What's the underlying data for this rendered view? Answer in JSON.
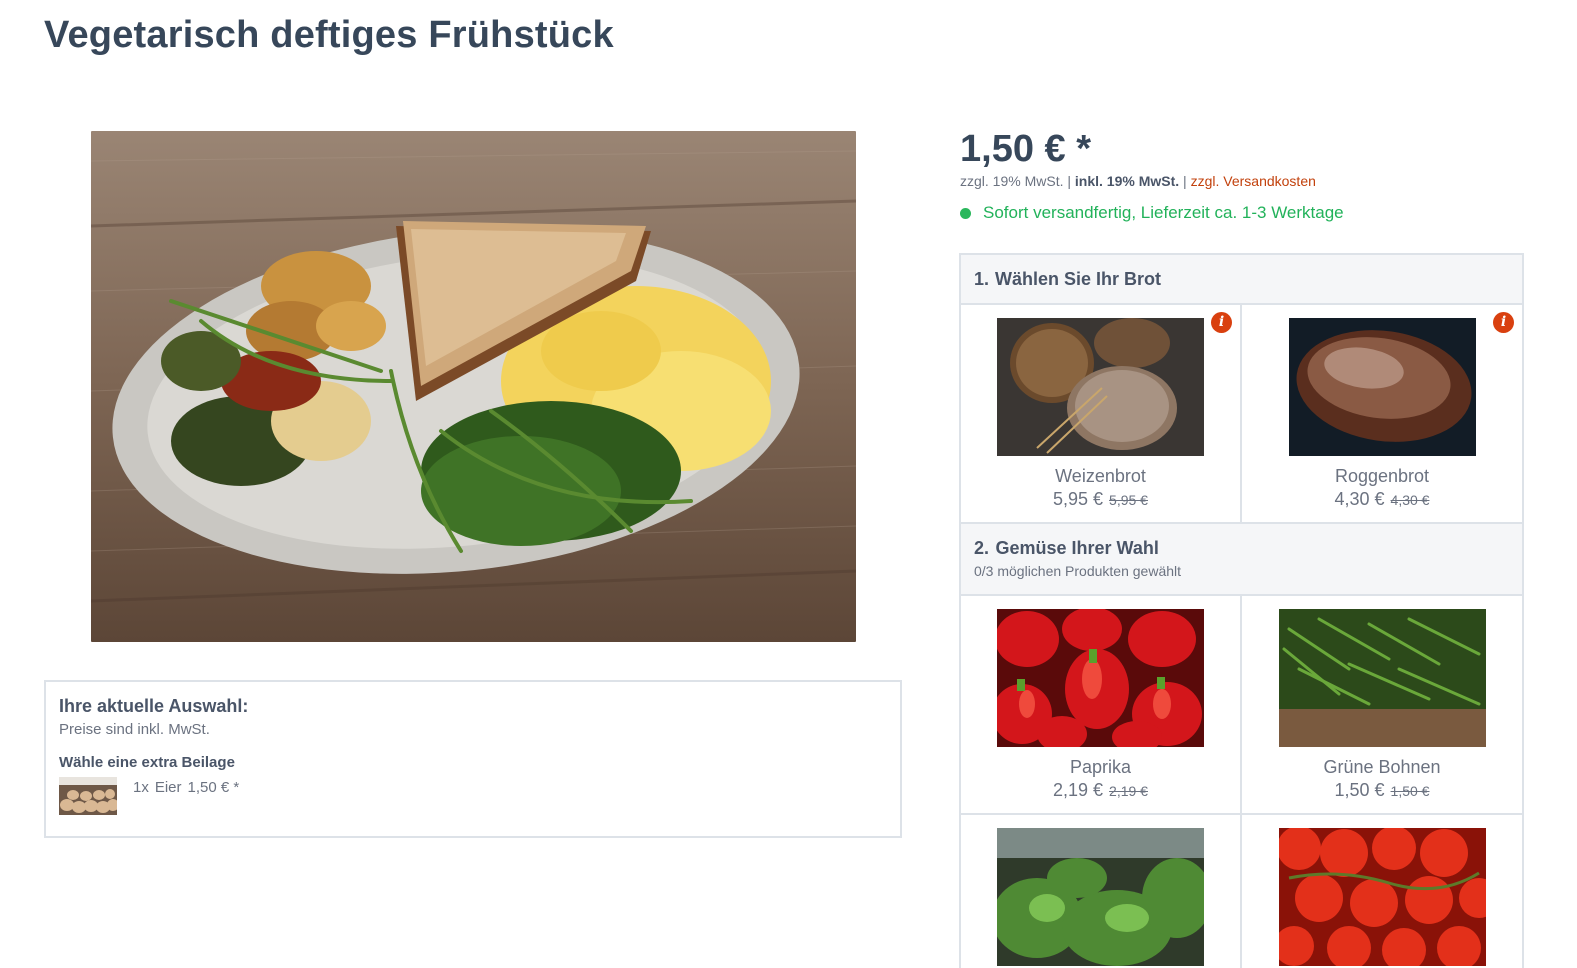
{
  "page": {
    "title": "Vegetarisch deftiges Frühstück"
  },
  "price": {
    "value": "1,50 € *",
    "tax_excl": "zzgl. 19% MwSt.",
    "sep1": "|",
    "tax_incl": "inkl. 19% MwSt.",
    "sep2": "|",
    "shipping_prefix": "zzgl.",
    "shipping_link": "Versandkosten"
  },
  "delivery": {
    "text": "Sofort versandfertig, Lieferzeit ca. 1-3 Werktage",
    "color": "#22b25a"
  },
  "selection": {
    "title": "Ihre aktuelle Auswahl:",
    "note": "Preise sind inkl. MwSt.",
    "group": "Wähle eine extra Beilage",
    "item": {
      "qty": "1x",
      "name": "Eier",
      "price": "1,50 € *"
    }
  },
  "config": {
    "group1": {
      "number": "1.",
      "title": "Wählen Sie Ihr Brot",
      "items": [
        {
          "name": "Weizenbrot",
          "price": "5,95 €",
          "old_price": "5,95 €",
          "info": "i"
        },
        {
          "name": "Roggenbrot",
          "price": "4,30 €",
          "old_price": "4,30 €",
          "info": "i"
        }
      ]
    },
    "group2": {
      "number": "2.",
      "title": "Gemüse Ihrer Wahl",
      "subtitle": "0/3 möglichen Produkten gewählt",
      "items": [
        {
          "name": "Paprika",
          "price": "2,19 €",
          "old_price": "2,19 €"
        },
        {
          "name": "Grüne Bohnen",
          "price": "1,50 €",
          "old_price": "1,50 €"
        },
        {
          "name": "",
          "price": "",
          "old_price": ""
        },
        {
          "name": "",
          "price": "",
          "old_price": ""
        }
      ]
    }
  },
  "colors": {
    "accent": "#c2410c",
    "heading": "#37475a",
    "info": "#d9400f"
  }
}
